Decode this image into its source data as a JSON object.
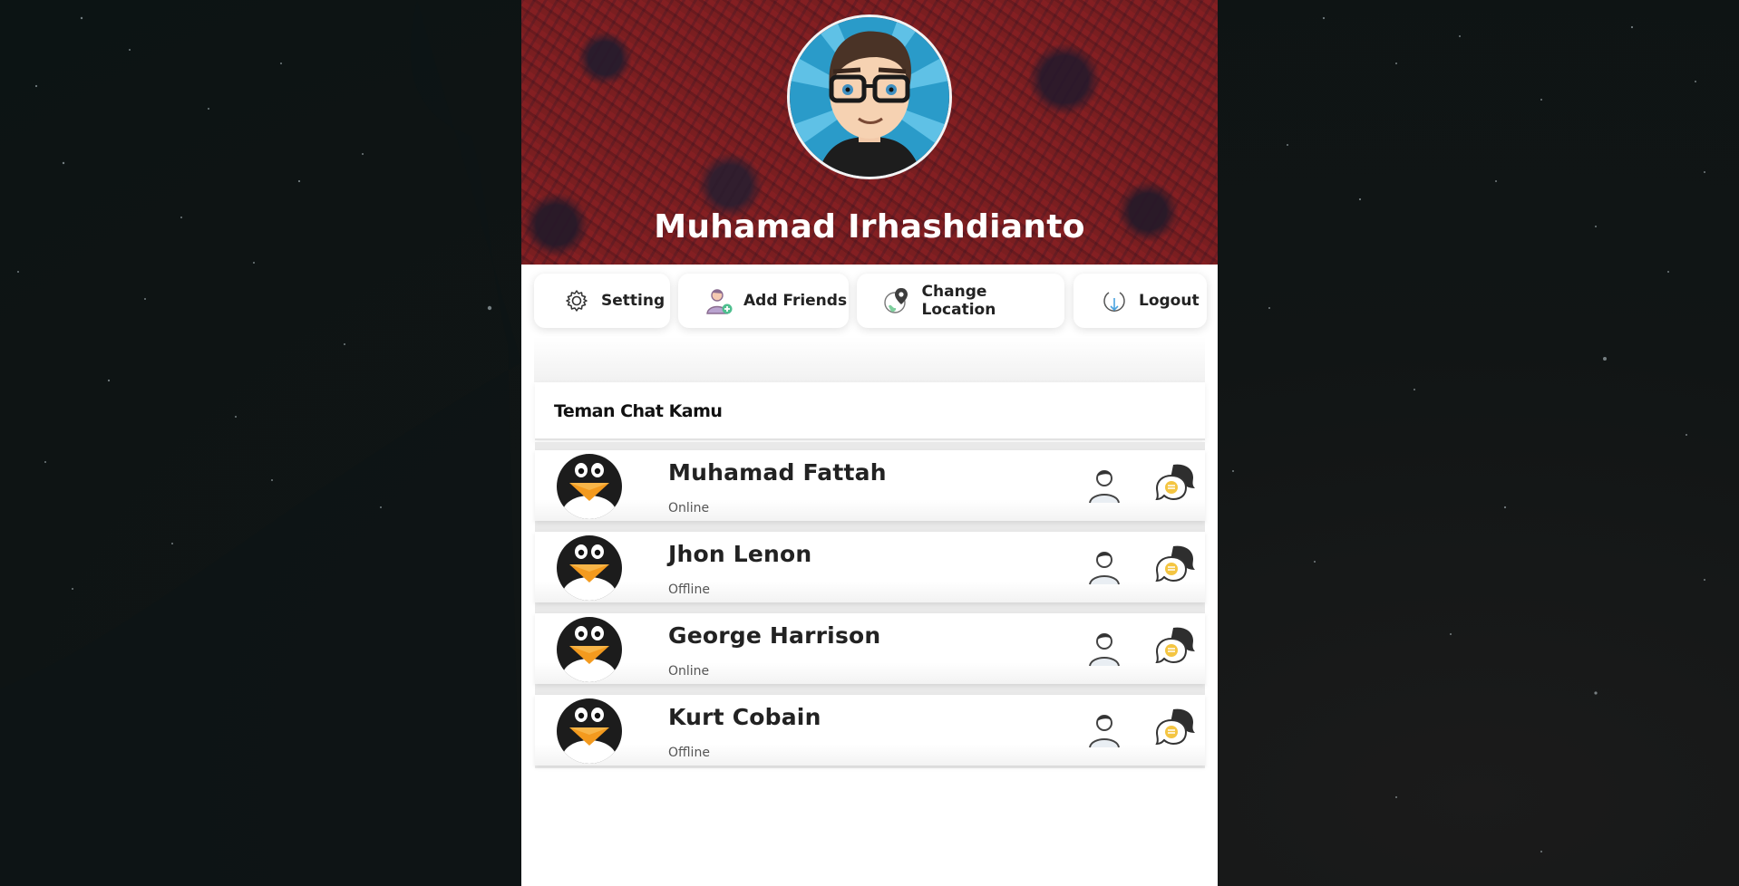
{
  "profile": {
    "name": "Muhamad Irhashdianto"
  },
  "actions": [
    {
      "label": "Setting",
      "icon": "gear-icon"
    },
    {
      "label": "Add Friends",
      "icon": "add-user-icon"
    },
    {
      "label": "Change Location",
      "icon": "location-pin-icon"
    },
    {
      "label": "Logout",
      "icon": "logout-icon"
    }
  ],
  "friends_list": {
    "title": "Teman Chat Kamu",
    "items": [
      {
        "name": "Muhamad Fattah",
        "status": "Online"
      },
      {
        "name": "Jhon Lenon",
        "status": "Offline"
      },
      {
        "name": "George Harrison",
        "status": "Online"
      },
      {
        "name": "Kurt Cobain",
        "status": "Offline"
      }
    ]
  },
  "colors": {
    "banner": "#7d1e21",
    "chat_badge": "#f4c542",
    "panel": "#ffffff"
  }
}
